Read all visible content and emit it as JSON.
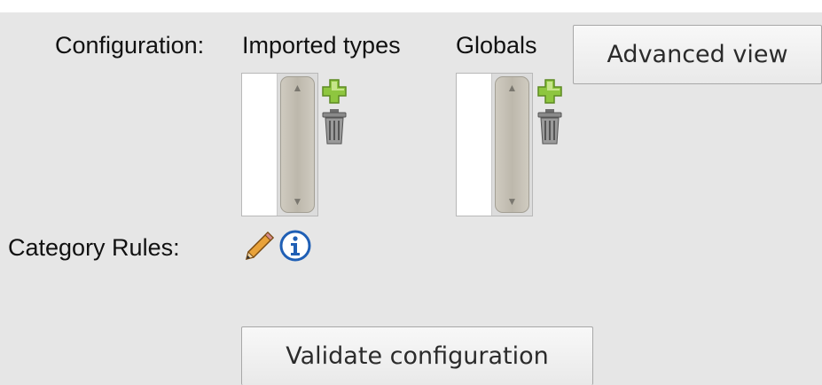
{
  "labels": {
    "configuration": "Configuration:",
    "imported_types": "Imported types",
    "globals": "Globals",
    "category_rules": "Category Rules:"
  },
  "buttons": {
    "advanced_view": "Advanced view",
    "validate_configuration": "Validate configuration"
  },
  "icons": {
    "imported_types_add": "plus-icon",
    "imported_types_delete": "trash-icon",
    "globals_add": "plus-icon",
    "globals_delete": "trash-icon",
    "category_rules_edit": "pencil-icon",
    "category_rules_info": "info-icon"
  },
  "colors": {
    "background": "#e6e6e6",
    "plus_green": "#8ec63f",
    "info_blue": "#1f5fb5"
  }
}
